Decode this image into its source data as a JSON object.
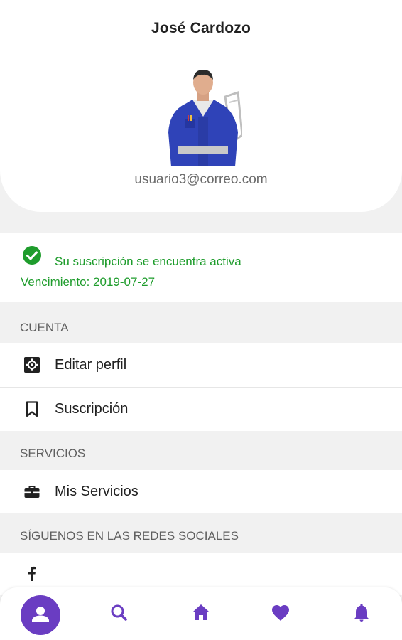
{
  "profile": {
    "name": "José Cardozo",
    "email": "usuario3@correo.com"
  },
  "subscription": {
    "status_text": "Su suscripción se encuentra activa",
    "expiration_text": "Vencimiento: 2019-07-27"
  },
  "sections": {
    "account": {
      "header": "CUENTA",
      "items": [
        {
          "label": "Editar perfil",
          "icon": "gear-square-icon"
        },
        {
          "label": "Suscripción",
          "icon": "bookmark-icon"
        }
      ]
    },
    "services": {
      "header": "SERVICIOS",
      "items": [
        {
          "label": "Mis Servicios",
          "icon": "briefcase-icon"
        }
      ]
    },
    "social": {
      "header": "SÍGUENOS EN LAS REDES SOCIALES",
      "items": [
        {
          "icon": "facebook-icon"
        }
      ]
    }
  },
  "bottom_nav": {
    "items": [
      "profile-icon",
      "search-icon",
      "home-icon",
      "heart-icon",
      "bell-icon"
    ],
    "active": "profile-icon"
  },
  "colors": {
    "accent": "#6a3dc2",
    "success": "#1e9c2c",
    "background": "#f1f1f1"
  }
}
